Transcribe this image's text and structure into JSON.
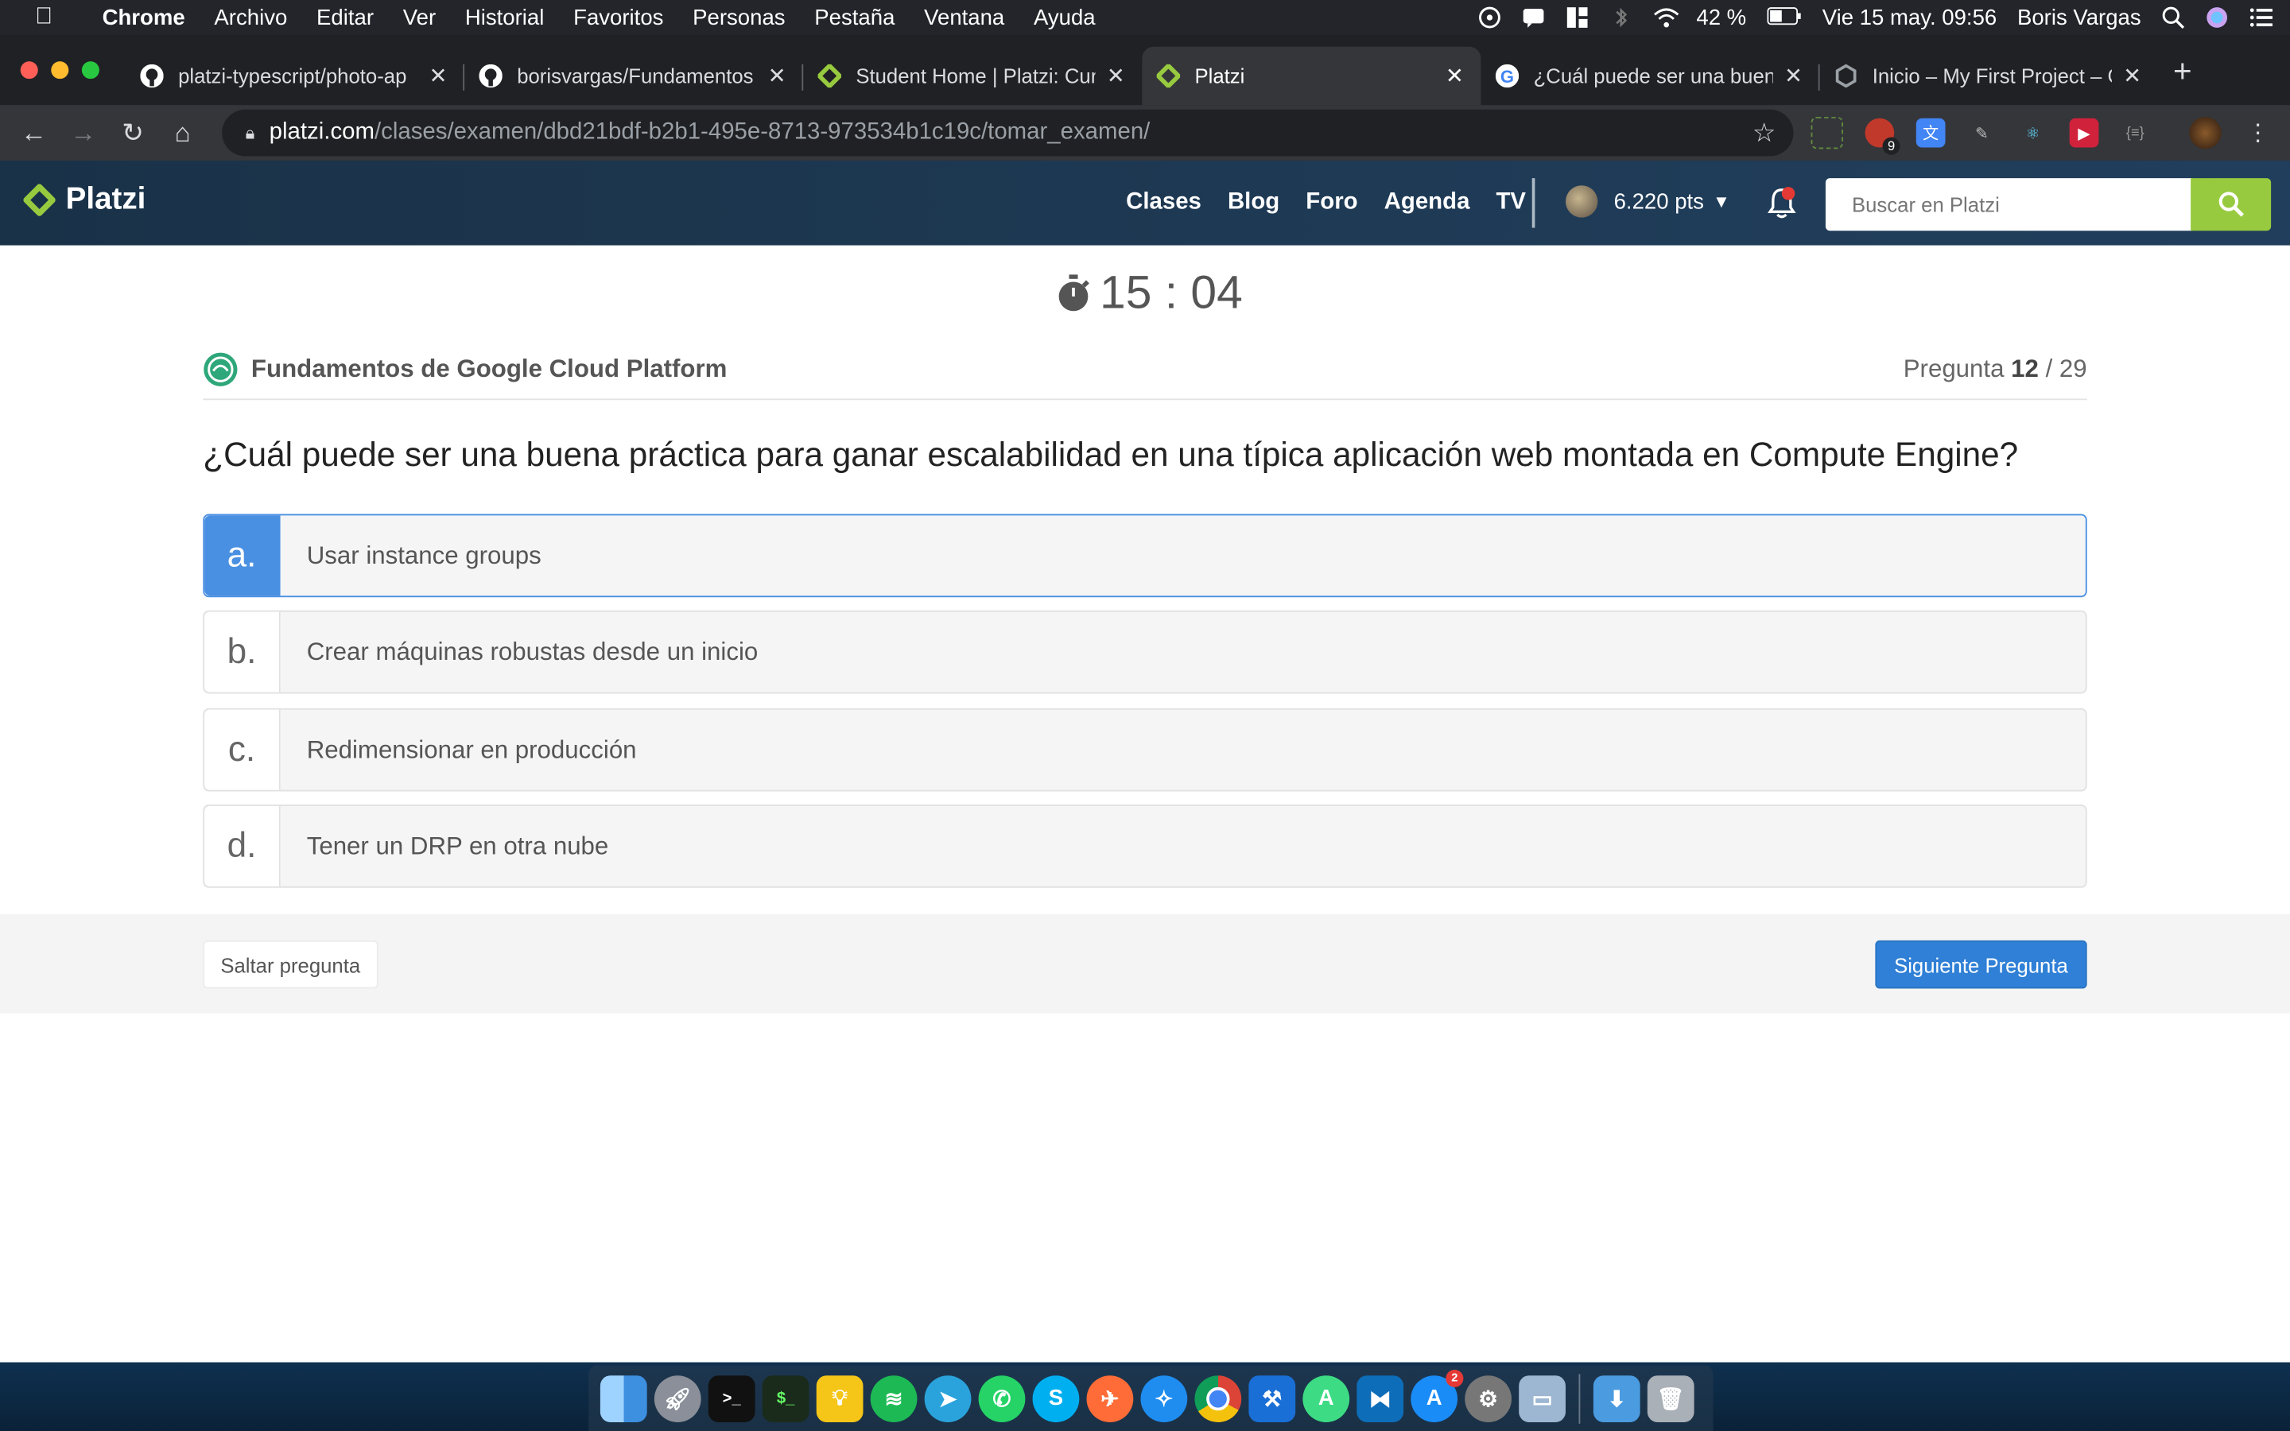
{
  "menubar": {
    "app_name": "Chrome",
    "menus": [
      "Archivo",
      "Editar",
      "Ver",
      "Historial",
      "Favoritos",
      "Personas",
      "Pestaña",
      "Ventana",
      "Ayuda"
    ],
    "battery": "42 %",
    "datetime": "Vie 15 may.  09:56",
    "user": "Boris Vargas"
  },
  "browser": {
    "tabs": [
      {
        "title": "platzi-typescript/photo-ap",
        "favicon": "github-icon"
      },
      {
        "title": "borisvargas/Fundamentos",
        "favicon": "github-icon"
      },
      {
        "title": "Student Home | Platzi: Cur",
        "favicon": "platzi-icon"
      },
      {
        "title": "Platzi",
        "favicon": "platzi-icon",
        "active": true
      },
      {
        "title": "¿Cuál puede ser una buen",
        "favicon": "google-icon"
      },
      {
        "title": "Inicio – My First Project – G",
        "favicon": "gcp-icon"
      }
    ],
    "new_tab": "+",
    "url_host": "platzi.com",
    "url_path": "/clases/examen/dbd21bdf-b2b1-495e-8713-973534b1c19c/tomar_examen/",
    "extension_badge": "9"
  },
  "platzi_header": {
    "logo_text": "Platzi",
    "nav": [
      "Clases",
      "Blog",
      "Foro",
      "Agenda",
      "TV"
    ],
    "points": "6.220 pts",
    "search_placeholder": "Buscar en Platzi"
  },
  "exam": {
    "timer": "15 : 04",
    "course": "Fundamentos de Google Cloud Platform",
    "question_label": "Pregunta",
    "question_current": "12",
    "question_total": " / 29",
    "question": "¿Cuál puede ser una buena práctica para ganar escalabilidad en una típica aplicación web montada en Compute Engine?",
    "options": [
      {
        "letter": "a.",
        "text": "Usar instance groups",
        "selected": true
      },
      {
        "letter": "b.",
        "text": "Crear máquinas robustas desde un inicio",
        "selected": false
      },
      {
        "letter": "c.",
        "text": "Redimensionar en producción",
        "selected": false
      },
      {
        "letter": "d.",
        "text": "Tener un DRP en otra nube",
        "selected": false
      }
    ],
    "skip_label": "Saltar pregunta",
    "next_label": "Siguiente Pregunta"
  },
  "colors": {
    "platzi_green": "#98ca3f",
    "selected_blue": "#4a90e2",
    "next_button_blue": "#2f80d6",
    "header_dark": "#1c3a55"
  },
  "dock": {
    "apps": [
      "finder-icon",
      "launchpad-icon",
      "terminal-icon",
      "iterm-icon",
      "idea-icon",
      "spotify-icon",
      "telegram-icon",
      "whatsapp-icon",
      "skype-icon",
      "postman-icon",
      "safari-icon",
      "chrome-icon",
      "xcode-icon",
      "android-studio-icon",
      "vscode-icon",
      "app-store-icon",
      "system-preferences-icon",
      "preview-icon"
    ],
    "app_store_badge": "2"
  }
}
